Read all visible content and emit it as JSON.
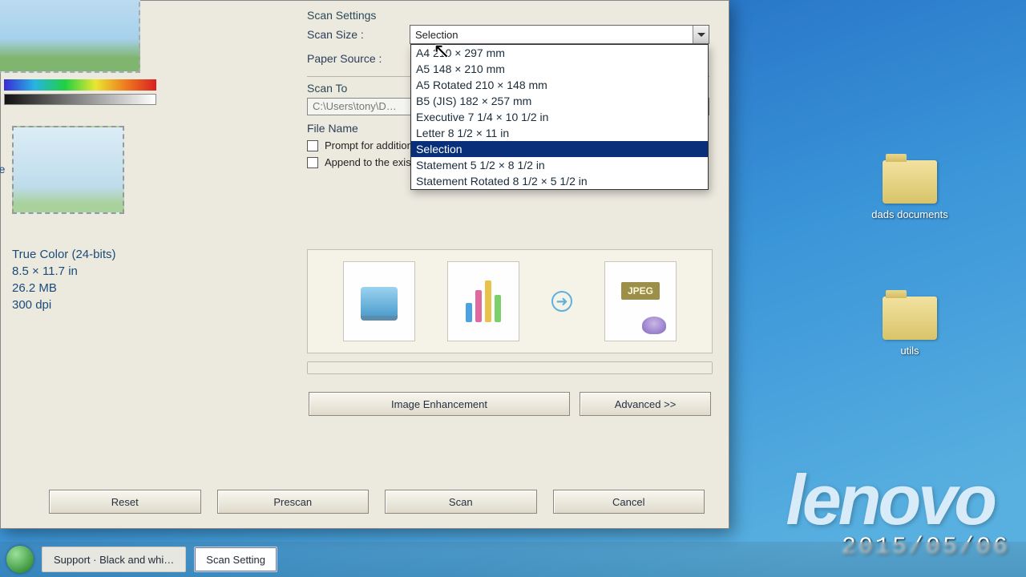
{
  "desktop": {
    "brand": "lenovo",
    "date_overlay": "2015/05/06",
    "icons": [
      {
        "label": "dads documents"
      },
      {
        "label": "utils"
      }
    ]
  },
  "dialog": {
    "settings_caption": "Scan Settings",
    "scan_size_label": "Scan Size :",
    "scan_size_value": "Selection",
    "dropdown_options": [
      "A4 210 × 297 mm",
      "A5 148 × 210 mm",
      "A5 Rotated 210 × 148 mm",
      "B5 (JIS) 182 × 257 mm",
      "Executive 7 1/4 × 10 1/2 in",
      "Letter 8 1/2 × 11 in",
      "Selection",
      "Statement 5 1/2 × 8 1/2 in",
      "Statement Rotated 8 1/2 × 5 1/2 in"
    ],
    "selected_index": 6,
    "paper_source_label": "Paper Source :",
    "scan_to_caption": "Scan To",
    "path_value": "C:\\Users\\tony\\D…",
    "file_name_label": "File Name",
    "prompt_pages_label": "Prompt for additional pages",
    "append_file_label": "Append to the existing file",
    "jpeg_chip": "JPEG",
    "image_enhancement_btn": "Image Enhancement",
    "advanced_btn": "Advanced >>",
    "reset_btn": "Reset",
    "prescan_btn": "Prescan",
    "scan_btn": "Scan",
    "cancel_btn": "Cancel",
    "thumb_label": "age",
    "info_line1": "True Color (24-bits)",
    "info_line2": "8.5 × 11.7 in",
    "info_line3": "26.2 MB",
    "info_line4": "300 dpi"
  },
  "taskbar": {
    "item1": "Support · Black and whi…",
    "item2": "Scan Setting"
  }
}
